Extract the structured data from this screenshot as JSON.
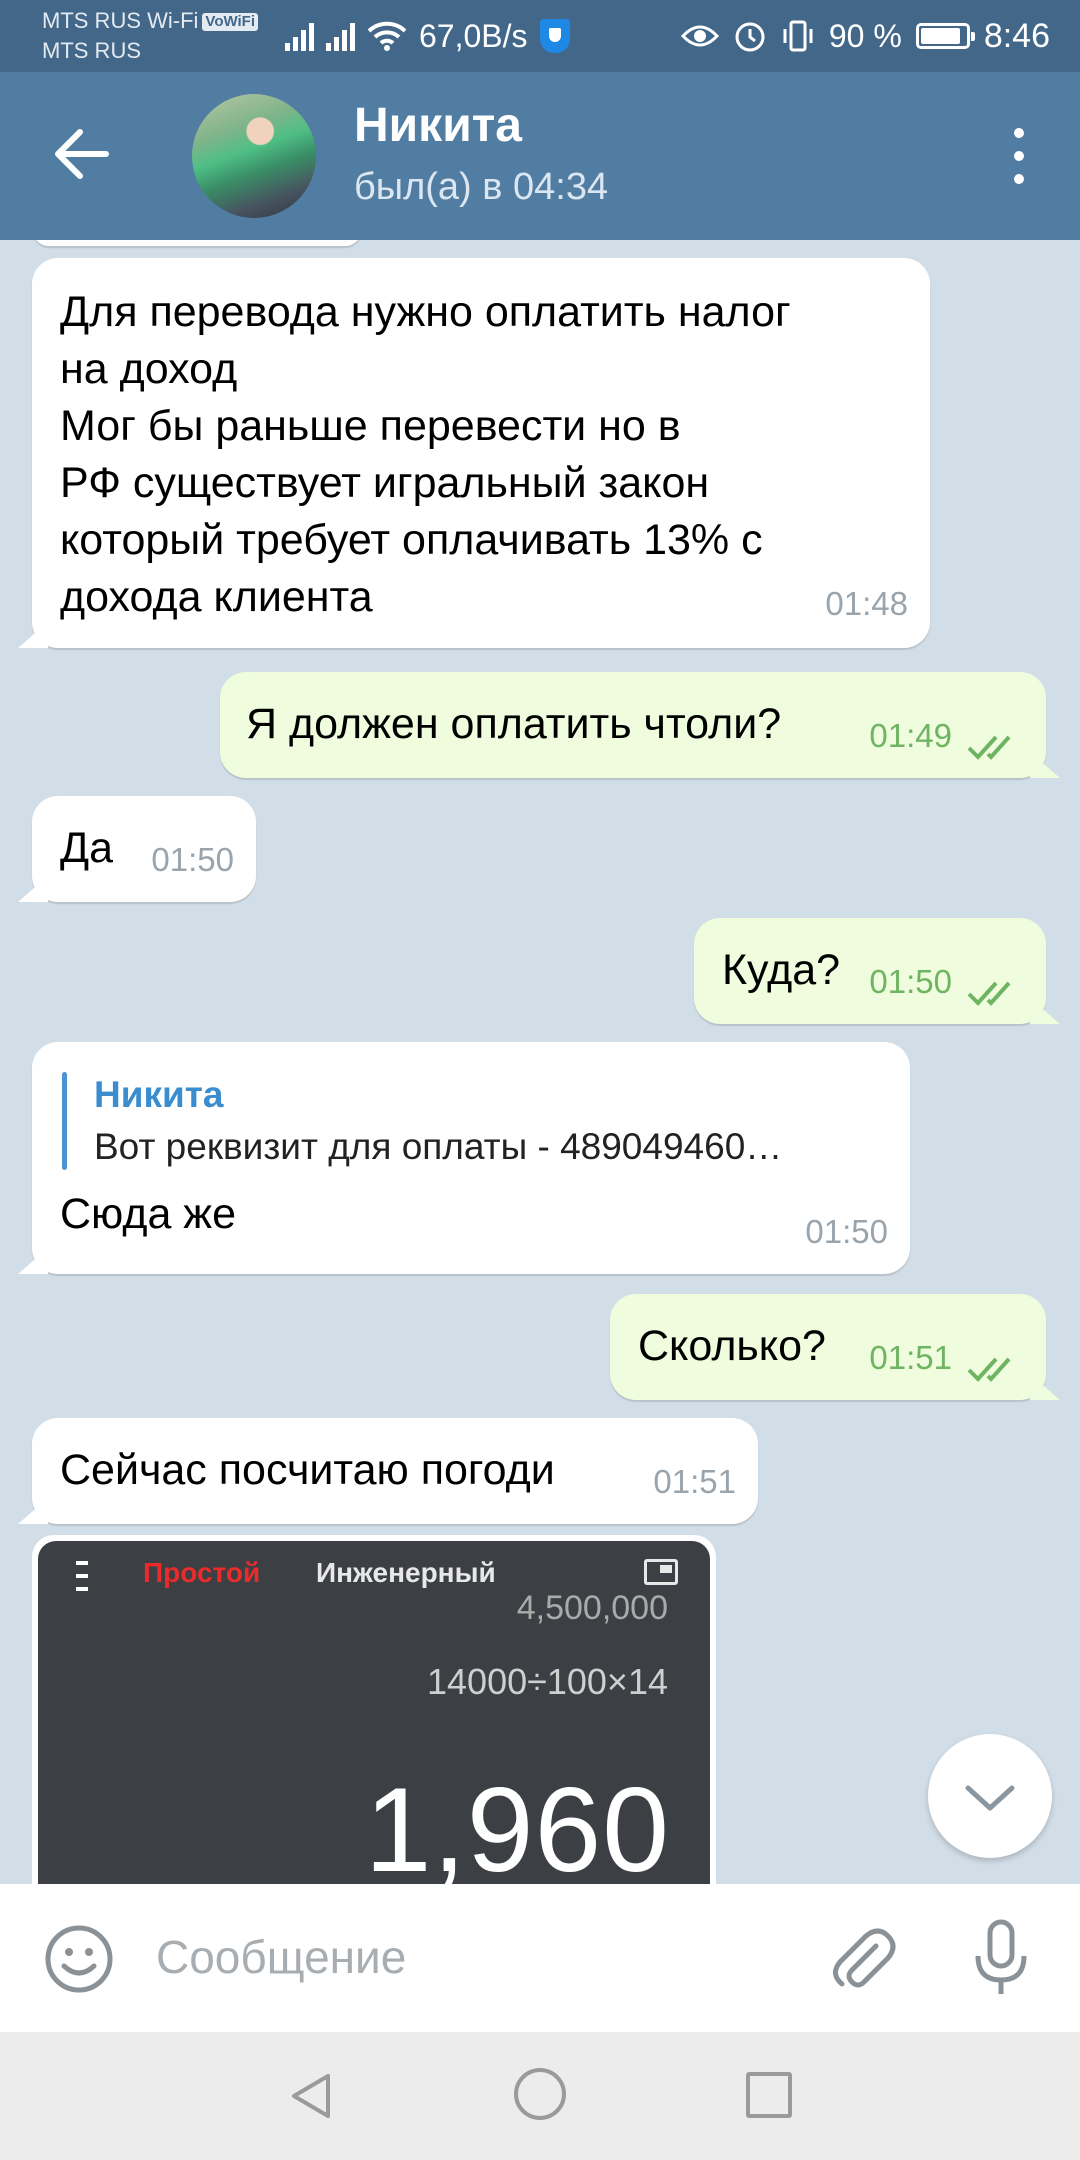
{
  "status_bar": {
    "carrier1": "MTS RUS Wi-Fi",
    "vowifi": "VoWiFi",
    "carrier2": "MTS RUS",
    "net_speed": "67,0B/s",
    "battery": "90 %",
    "time": "8:46"
  },
  "header": {
    "name": "Никита",
    "status": "был(а) в 04:34"
  },
  "messages": [
    {
      "dir": "in",
      "lines": [
        "Для перевода нужно оплатить налог",
        "на доход",
        "Мог бы раньше перевести но в",
        "РФ существует игральный закон",
        "который требует оплачивать 13% с",
        "дохода клиента"
      ],
      "time": "01:48"
    },
    {
      "dir": "out",
      "text": "Я должен оплатить чтоли?",
      "time": "01:49"
    },
    {
      "dir": "in",
      "text": "Да",
      "time": "01:50"
    },
    {
      "dir": "out",
      "text": "Куда?",
      "time": "01:50"
    },
    {
      "dir": "in",
      "reply_name": "Никита",
      "reply_text": "Вот реквизит для оплаты -  489049460…",
      "text": "Сюда же",
      "time": "01:50"
    },
    {
      "dir": "out",
      "text": "Сколько?",
      "time": "01:51"
    },
    {
      "dir": "in",
      "text": "Сейчас посчитаю погоди",
      "time": "01:51"
    }
  ],
  "photo": {
    "tab_simple": "Простой",
    "tab_engineering": "Инженерный",
    "previous": "4,500,000",
    "expression": "14000÷100×14",
    "result": "1,960"
  },
  "input": {
    "placeholder": "Сообщение"
  },
  "colors": {
    "header": "#517da2",
    "status_bar": "#436789",
    "outgoing_bubble": "#effdde",
    "chat_background": "#d1dde7"
  }
}
